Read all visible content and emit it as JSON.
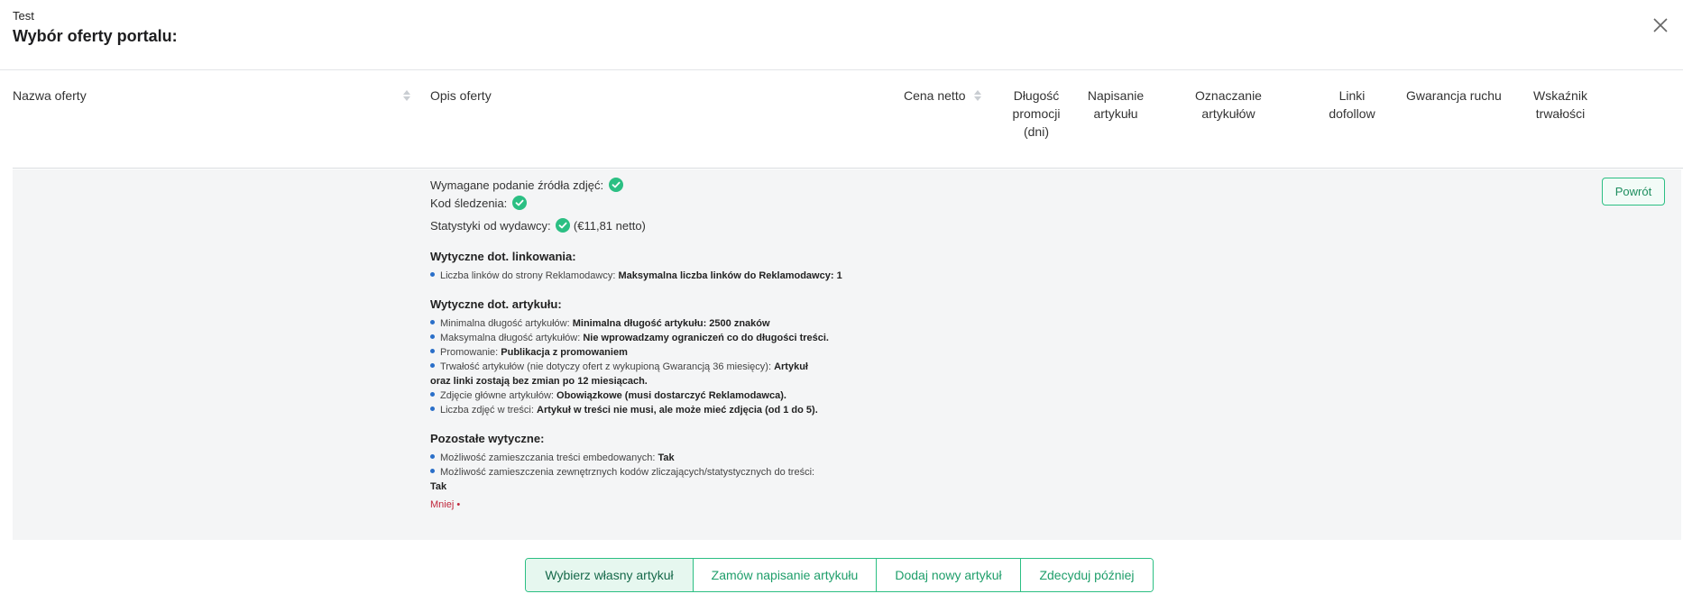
{
  "header": {
    "subtitle": "Test",
    "title": "Wybór oferty portalu:"
  },
  "table": {
    "columns": [
      {
        "id": "name",
        "label": "Nazwa oferty",
        "sortable": true
      },
      {
        "id": "description",
        "label": "Opis oferty",
        "sortable": false
      },
      {
        "id": "price",
        "label": "Cena netto",
        "sortable": true
      },
      {
        "id": "duration",
        "label": "Długość promocji (dni)",
        "line1": "Długość",
        "line2": "promocji",
        "line3": "(dni)"
      },
      {
        "id": "writing",
        "label": "Napisanie artykułu",
        "line1": "Napisanie",
        "line2": "artykułu"
      },
      {
        "id": "tagging",
        "label": "Oznaczanie artykułów",
        "line1": "Oznaczanie",
        "line2": "artykułów"
      },
      {
        "id": "dofollow",
        "label": "Linki dofollow",
        "line1": "Linki",
        "line2": "dofollow"
      },
      {
        "id": "traffic",
        "label": "Gwarancja ruchu"
      },
      {
        "id": "durability",
        "label": "Wskaźnik trwałości",
        "line1": "Wskaźnik",
        "line2": "trwałości"
      }
    ]
  },
  "details": {
    "photo_source_label": "Wymagane podanie źródła zdjęć:",
    "tracking_code_label": "Kod śledzenia:",
    "publisher_stats_label": "Statystyki od wydawcy:",
    "publisher_stats_price": "(€11,81 netto)",
    "linking": {
      "title": "Wytyczne dot. linkowania:",
      "items": [
        {
          "label": "Liczba linków do strony Reklamodawcy:",
          "value": "Maksymalna liczba linków do Reklamodawcy: 1"
        }
      ]
    },
    "article": {
      "title": "Wytyczne dot. artykułu:",
      "items": [
        {
          "label": "Minimalna długość artykułów:",
          "value": "Minimalna długość artykułu: 2500 znaków"
        },
        {
          "label": "Maksymalna długość artykułów:",
          "value": "Nie wprowadzamy ograniczeń co do długości treści."
        },
        {
          "label": "Promowanie:",
          "value": "Publikacja z promowaniem"
        },
        {
          "label": "Trwałość artykułów (nie dotyczy ofert z wykupioną Gwarancją 36 miesięcy):",
          "value": "Artykuł",
          "cont": "oraz linki zostają bez zmian po 12 miesiącach."
        },
        {
          "label": "Zdjęcie główne artykułów:",
          "value": "Obowiązkowe (musi dostarczyć Reklamodawca)."
        },
        {
          "label": "Liczba zdjęć w treści:",
          "value": "Artykuł w treści nie musi, ale może mieć zdjęcia (od 1 do 5)."
        }
      ]
    },
    "other": {
      "title": "Pozostałe wytyczne:",
      "items": [
        {
          "label": "Możliwość zamieszczania treści embedowanych:",
          "value": "Tak"
        },
        {
          "label": "Możliwość zamieszczenia zewnętrznych kodów zliczających/statystycznych do treści:",
          "value": "",
          "cont": "Tak"
        }
      ]
    },
    "less_label": "Mniej",
    "back_label": "Powrót"
  },
  "actions": {
    "own_article": "Wybierz własny artykuł",
    "order_writing": "Zamów napisanie artykułu",
    "add_new": "Dodaj nowy artykuł",
    "decide_later": "Zdecyduj później"
  },
  "colors": {
    "accent": "#2bbf83",
    "danger_link": "#c0283d",
    "bullet": "#2a6fc9"
  }
}
